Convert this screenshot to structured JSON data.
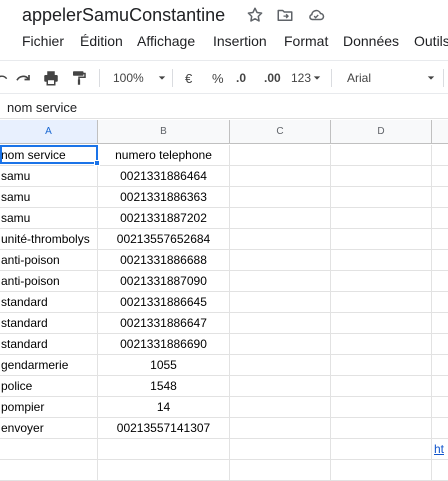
{
  "title": "appelerSamuConstantine",
  "menu": [
    "Fichier",
    "Édition",
    "Affichage",
    "Insertion",
    "Format",
    "Données",
    "Outils"
  ],
  "toolbar": {
    "zoom": "100%",
    "currency": "€",
    "percent": "%",
    "decrease_decimals": ".0",
    "increase_decimals": ".00",
    "more_formats": "123",
    "font": "Arial"
  },
  "formula_bar": {
    "value": "nom service"
  },
  "columns": [
    "A",
    "B",
    "C",
    "D"
  ],
  "rows": [
    {
      "a": "nom service",
      "b": "numero telephone"
    },
    {
      "a": "samu",
      "b": "0021331886464"
    },
    {
      "a": "samu",
      "b": "0021331886363"
    },
    {
      "a": "samu",
      "b": "0021331887202"
    },
    {
      "a": "unité-thrombolys",
      "b": "00213557652684"
    },
    {
      "a": "anti-poison",
      "b": "0021331886688"
    },
    {
      "a": "anti-poison",
      "b": "0021331887090"
    },
    {
      "a": "standard",
      "b": "0021331886645"
    },
    {
      "a": "standard",
      "b": "0021331886647"
    },
    {
      "a": "standard",
      "b": "0021331886690"
    },
    {
      "a": "gendarmerie",
      "b": "1055"
    },
    {
      "a": "police",
      "b": "1548"
    },
    {
      "a": "pompier",
      "b": "14"
    },
    {
      "a": "envoyer",
      "b": "00213557141307"
    },
    {
      "a": "",
      "b": ""
    },
    {
      "a": "",
      "b": ""
    }
  ],
  "link_cell": "ht",
  "colors": {
    "selection": "#1a73e8",
    "link": "#1155cc",
    "header_bg": "#f8f9fa"
  }
}
